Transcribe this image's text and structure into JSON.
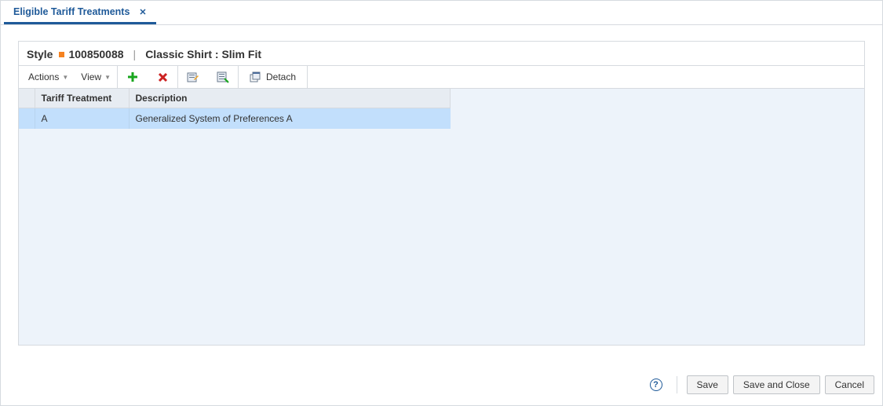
{
  "tab": {
    "label": "Eligible Tariff Treatments"
  },
  "header": {
    "style_label": "Style",
    "style_code": "100850088",
    "product_name": "Classic Shirt : Slim Fit"
  },
  "toolbar": {
    "actions_label": "Actions",
    "view_label": "View",
    "detach_label": "Detach"
  },
  "table": {
    "columns": {
      "tariff_treatment": "Tariff Treatment",
      "description": "Description"
    },
    "rows": [
      {
        "tariff_treatment": "A",
        "description": "Generalized System of Preferences A"
      }
    ]
  },
  "footer": {
    "help_glyph": "?",
    "save": "Save",
    "save_and_close": "Save and Close",
    "cancel": "Cancel"
  }
}
